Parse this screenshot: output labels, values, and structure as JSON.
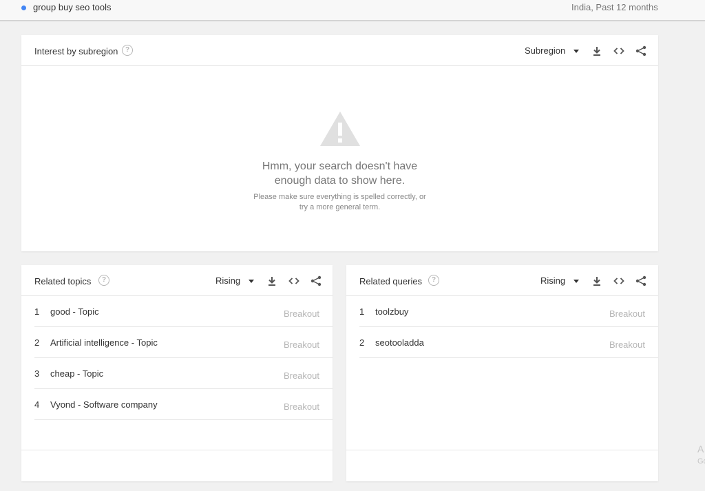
{
  "top": {
    "term": "group buy seo tools",
    "meta": "India, Past 12 months",
    "term_color": "#4285f4"
  },
  "subregion_card": {
    "title": "Interest by subregion",
    "help_icon": "?",
    "dropdown_label": "Subregion",
    "empty_title_line1": "Hmm, your search doesn't have",
    "empty_title_line2": "enough data to show here.",
    "empty_sub_line1": "Please make sure everything is spelled correctly, or",
    "empty_sub_line2": "try a more general term.",
    "icons": [
      "download-icon",
      "embed-icon",
      "share-icon",
      "warning-icon"
    ]
  },
  "related_topics": {
    "title": "Related topics",
    "help_icon": "?",
    "dropdown_label": "Rising",
    "rows": [
      {
        "num": "1",
        "text": "good - Topic",
        "value": "Breakout"
      },
      {
        "num": "2",
        "text": "Artificial intelligence - Topic",
        "value": "Breakout"
      },
      {
        "num": "3",
        "text": "cheap - Topic",
        "value": "Breakout"
      },
      {
        "num": "4",
        "text": "Vyond - Software company",
        "value": "Breakout"
      }
    ]
  },
  "related_queries": {
    "title": "Related queries",
    "help_icon": "?",
    "dropdown_label": "Rising",
    "rows": [
      {
        "num": "1",
        "text": "toolzbuy",
        "value": "Breakout"
      },
      {
        "num": "2",
        "text": "seotooladda",
        "value": "Breakout"
      }
    ]
  },
  "corner": {
    "letter1": "A",
    "letter2": "Go"
  }
}
